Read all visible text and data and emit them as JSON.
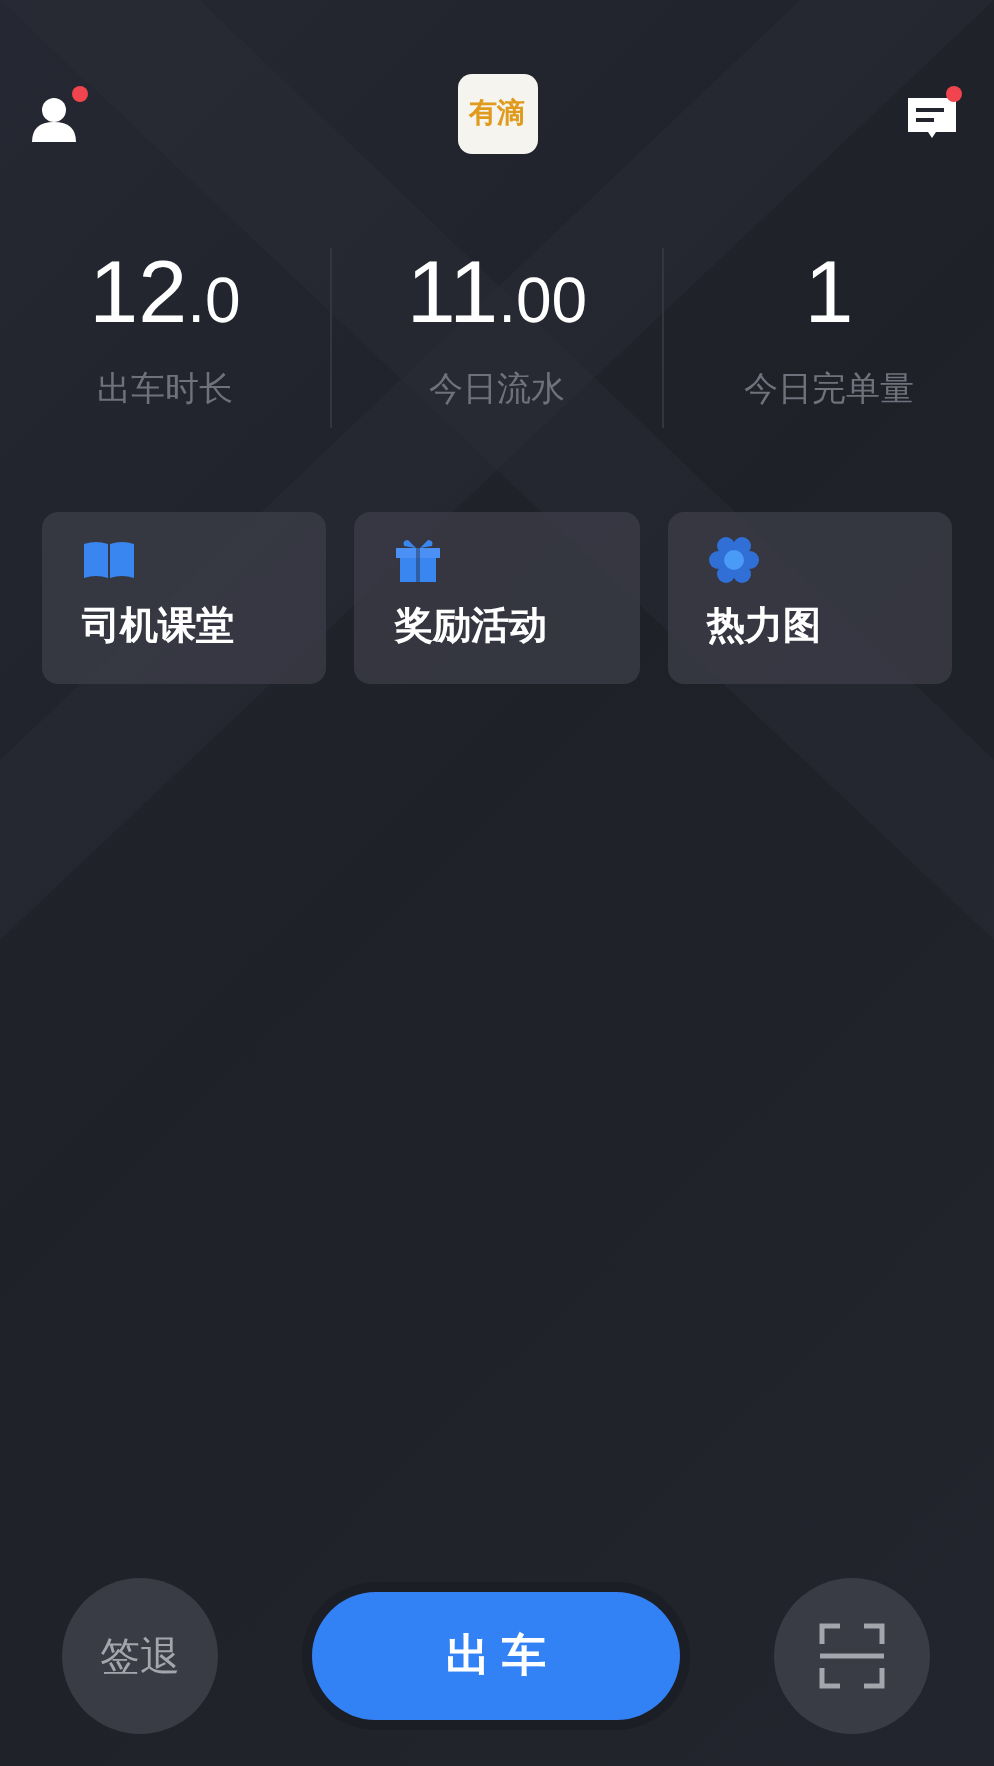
{
  "header": {
    "profile": {
      "notification": true
    },
    "logo": "有滴",
    "messages": {
      "notification": true
    }
  },
  "stats": [
    {
      "value": "12",
      "decimals": ".0",
      "label": "出车时长"
    },
    {
      "value": "11",
      "decimals": ".00",
      "label": "今日流水"
    },
    {
      "value": "1",
      "label": "今日完单量"
    }
  ],
  "cards": [
    {
      "kind": "book",
      "label": "司机课堂"
    },
    {
      "kind": "gift",
      "label": "奖励活动"
    },
    {
      "kind": "heatmap",
      "label": "热力图"
    }
  ],
  "bottom": {
    "sign_out": "签退",
    "start": "出 车"
  }
}
